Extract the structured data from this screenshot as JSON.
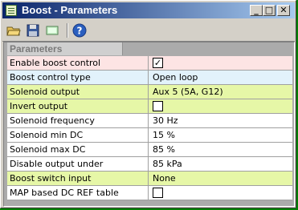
{
  "window": {
    "title": "Boost - Parameters"
  },
  "toolbar": {
    "buttons": [
      "folder-open-icon",
      "save-icon",
      "panel-icon",
      "help-icon"
    ]
  },
  "section_header": "Parameters",
  "rows": [
    {
      "label": "Enable boost control",
      "value": "",
      "checked": true,
      "type": "checkbox",
      "color": "#fde4e4"
    },
    {
      "label": "Boost control type",
      "value": "Open loop",
      "type": "text",
      "color": "#e2f2fb"
    },
    {
      "label": "Solenoid output",
      "value": "Aux 5 (5A, G12)",
      "type": "text",
      "color": "#e6f7a7"
    },
    {
      "label": "Invert output",
      "value": "",
      "checked": false,
      "type": "checkbox",
      "color": "#e6f7a7"
    },
    {
      "label": "Solenoid frequency",
      "value": "30 Hz",
      "type": "text",
      "color": "#ffffff"
    },
    {
      "label": "Solenoid min DC",
      "value": "15 %",
      "type": "text",
      "color": "#ffffff"
    },
    {
      "label": "Solenoid max DC",
      "value": "85 %",
      "type": "text",
      "color": "#ffffff"
    },
    {
      "label": "Disable output under",
      "value": "85 kPa",
      "type": "text",
      "color": "#ffffff"
    },
    {
      "label": "Boost switch input",
      "value": "None",
      "type": "text",
      "color": "#e6f7a7"
    },
    {
      "label": "MAP based DC REF table",
      "value": "",
      "checked": false,
      "type": "checkbox",
      "color": "#ffffff"
    }
  ]
}
